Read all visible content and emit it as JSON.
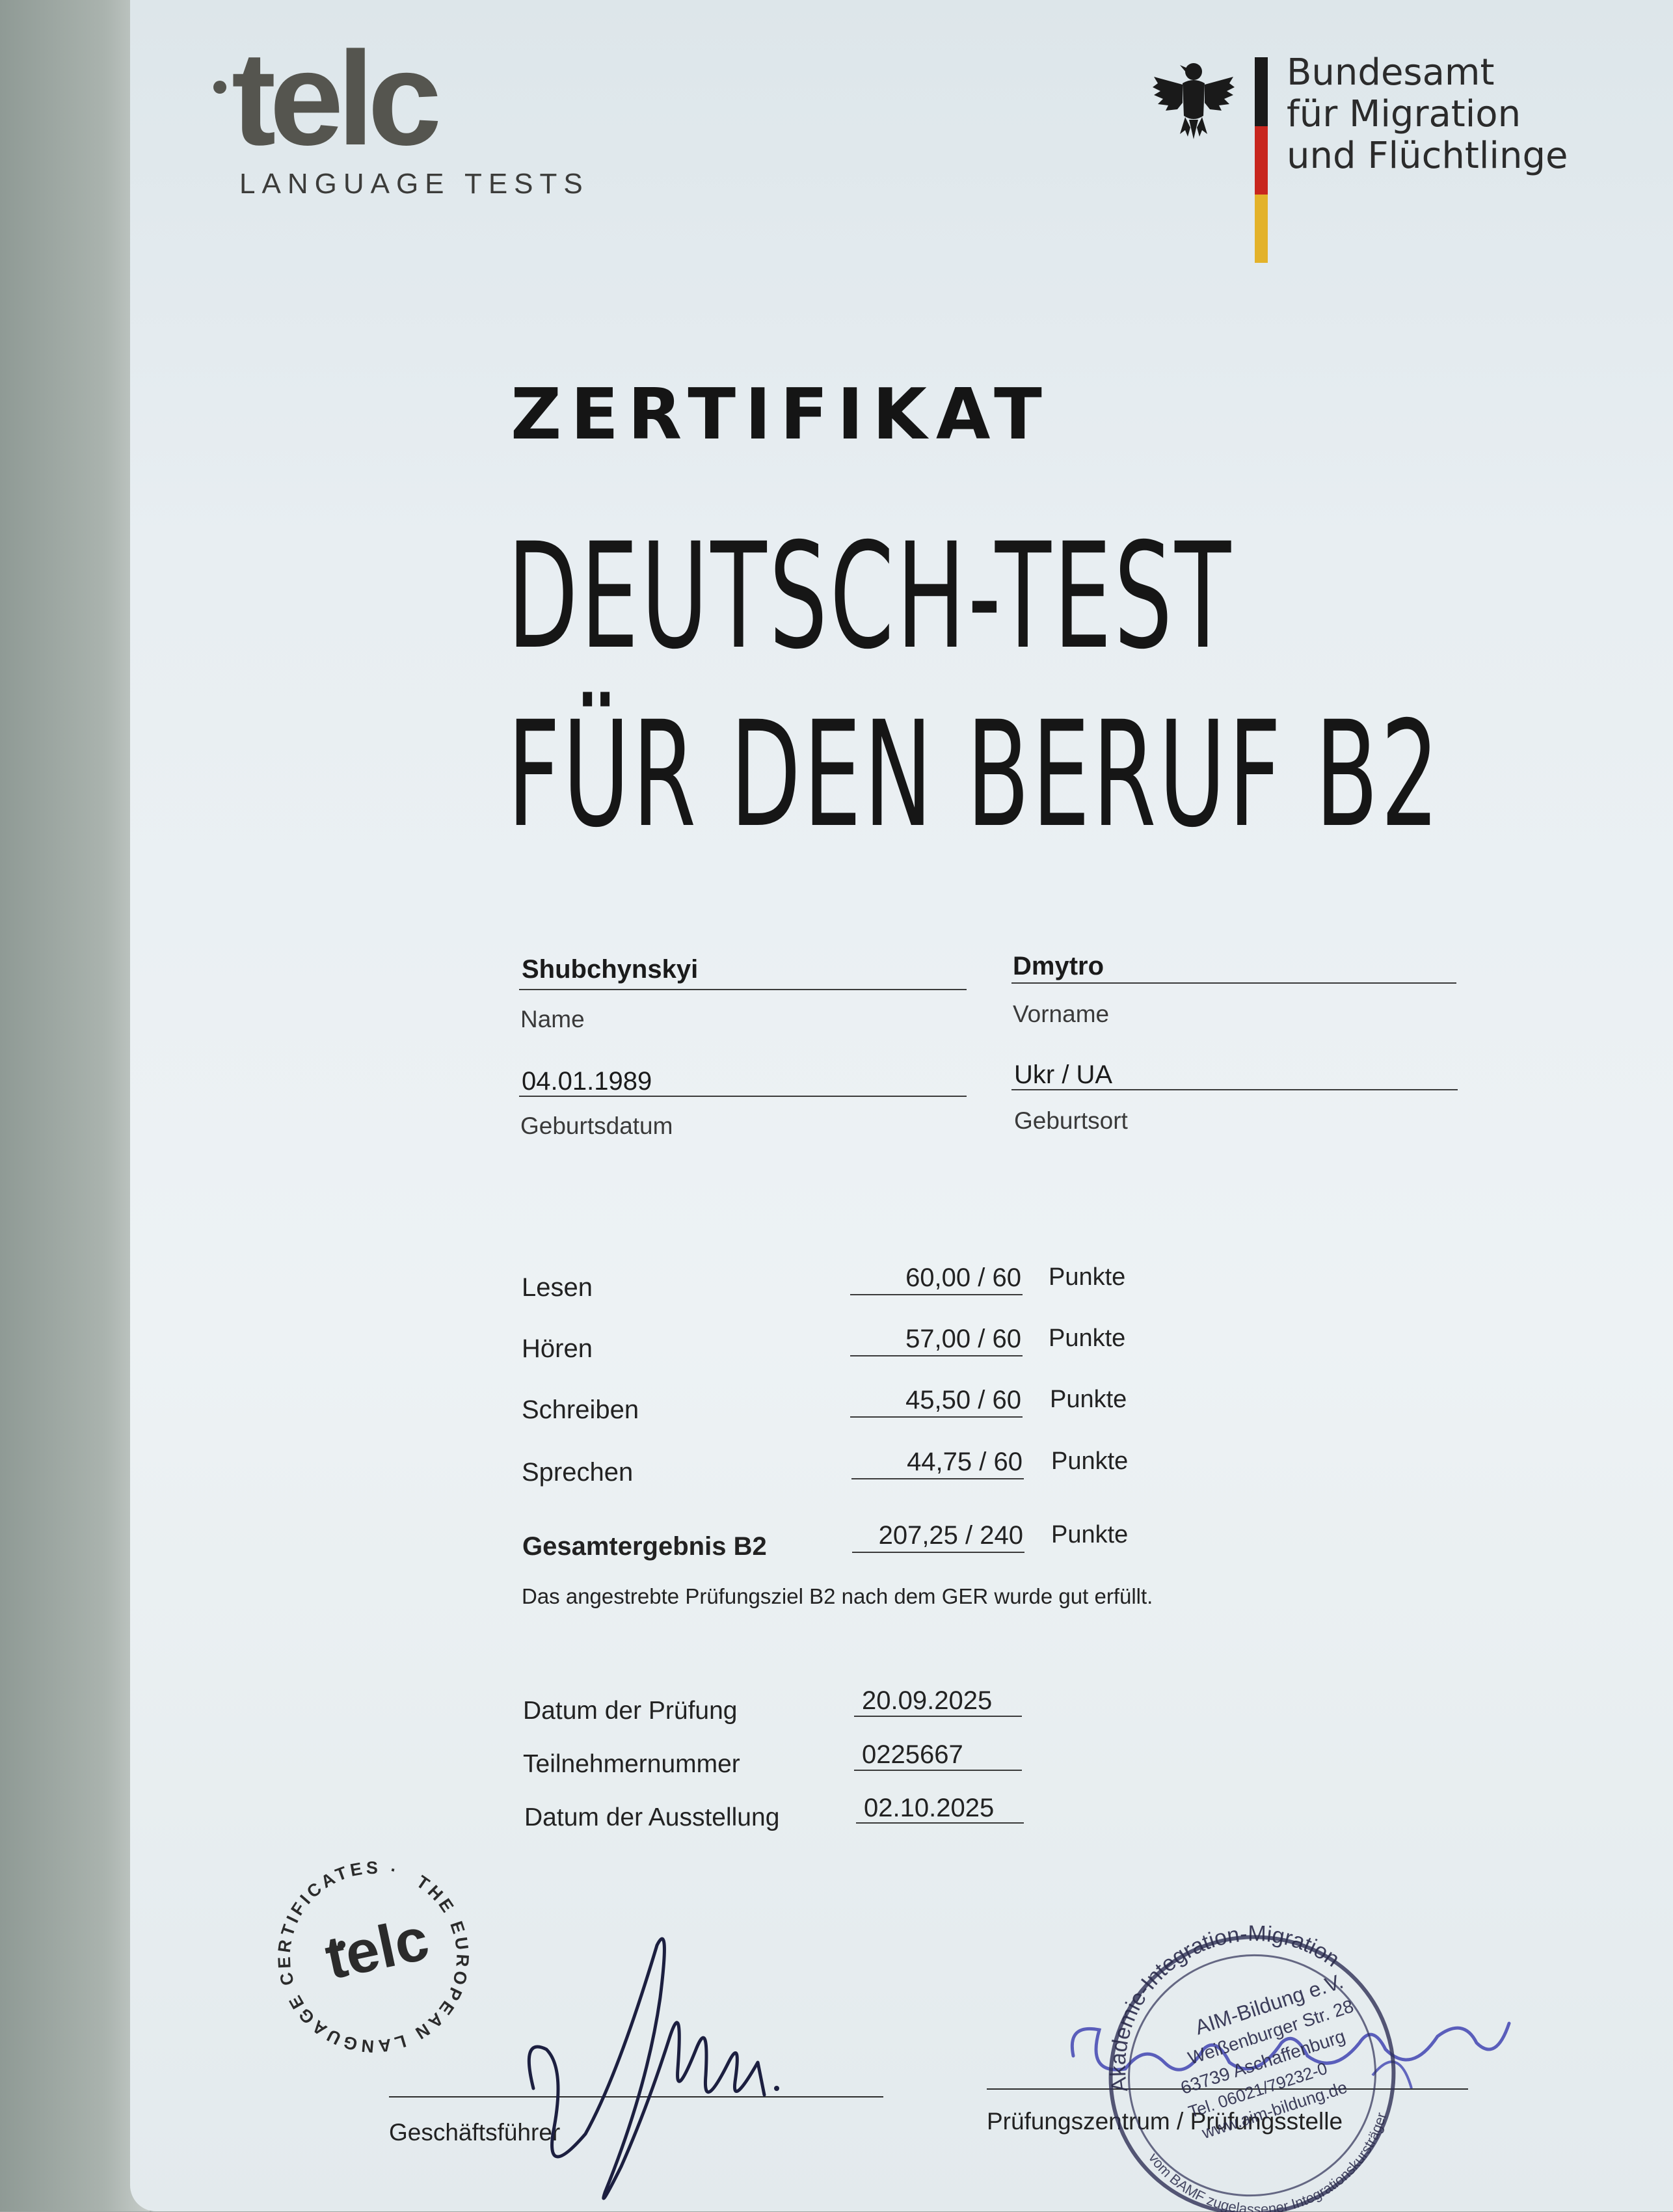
{
  "logo": {
    "telc": "telc",
    "subtitle": "LANGUAGE TESTS"
  },
  "bamf": {
    "line1": "Bundesamt",
    "line2": "für Migration",
    "line3": "und Flüchtlinge"
  },
  "header": {
    "label": "ZERTIFIKAT",
    "title_line1": "DEUTSCH-TEST",
    "title_line2": "FÜR DEN BERUF B2"
  },
  "person": {
    "name": {
      "value": "Shubchynskyi",
      "label": "Name"
    },
    "vorname": {
      "value": "Dmytro",
      "label": "Vorname"
    },
    "geburtsdatum": {
      "value": "04.01.1989",
      "label": "Geburtsdatum"
    },
    "geburtsort": {
      "value": "Ukr / UA",
      "label": "Geburtsort"
    }
  },
  "scores": [
    {
      "label": "Lesen",
      "value": "60,00 / 60",
      "unit": "Punkte"
    },
    {
      "label": "Hören",
      "value": "57,00 / 60",
      "unit": "Punkte"
    },
    {
      "label": "Schreiben",
      "value": "45,50 / 60",
      "unit": "Punkte"
    },
    {
      "label": "Sprechen",
      "value": "44,75 / 60",
      "unit": "Punkte"
    }
  ],
  "total": {
    "label": "Gesamtergebnis B2",
    "value": "207,25  / 240",
    "unit": "Punkte"
  },
  "note": "Das angestrebte Prüfungsziel B2 nach dem GER wurde gut erfüllt.",
  "dates": [
    {
      "label": "Datum der Prüfung",
      "value": "20.09.2025"
    },
    {
      "label": "Teilnehmernummer",
      "value": "0225667"
    },
    {
      "label": "Datum der Ausstellung",
      "value": "02.10.2025"
    }
  ],
  "signatures": {
    "left_label": "Geschäftsführer",
    "right_label": "Prüfungszentrum / Prüfungsstelle"
  },
  "seal": {
    "ring_text": "THE EUROPEAN LANGUAGE CERTIFICATES · ",
    "center": "telc"
  },
  "stamp": {
    "ring_top": "Akademie-Integration-Migration",
    "ring_bottom": "vom BAMF zugelassener Integrationskursträger",
    "lines": [
      "AIM-Bildung e.V.",
      "Weißenburger Str. 28",
      "63739 Aschaffenburg",
      "Tel. 06021/79232-0",
      "www.aim-bildung.de"
    ]
  },
  "colors": {
    "flag_black": "#1a1a1a",
    "flag_red": "#c8261e",
    "flag_gold": "#e3b22a",
    "stamp_ink": "#3a3f8f"
  }
}
